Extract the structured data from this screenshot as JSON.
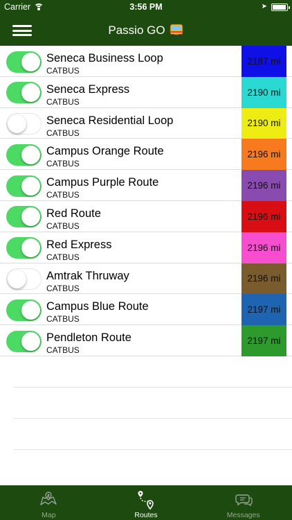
{
  "status_bar": {
    "carrier": "Carrier",
    "time": "3:56 PM"
  },
  "header": {
    "title": "Passio GO",
    "menu_icon": "hamburger-menu-icon",
    "title_icon": "bus-icon"
  },
  "routes": [
    {
      "name": "Seneca Business Loop",
      "agency": "CATBUS",
      "enabled": true,
      "distance": "2187 mi",
      "color": "#0f0fe8",
      "text_color": "#111111"
    },
    {
      "name": "Seneca Express",
      "agency": "CATBUS",
      "enabled": true,
      "distance": "2190 mi",
      "color": "#2bd9d3",
      "text_color": "#111111"
    },
    {
      "name": "Seneca Residential Loop",
      "agency": "CATBUS",
      "enabled": false,
      "distance": "2190 mi",
      "color": "#eded14",
      "text_color": "#111111"
    },
    {
      "name": "Campus Orange Route",
      "agency": "CATBUS",
      "enabled": true,
      "distance": "2196 mi",
      "color": "#f77a1e",
      "text_color": "#111111"
    },
    {
      "name": "Campus Purple Route",
      "agency": "CATBUS",
      "enabled": true,
      "distance": "2196 mi",
      "color": "#8a4bb0",
      "text_color": "#111111"
    },
    {
      "name": "Red Route",
      "agency": "CATBUS",
      "enabled": true,
      "distance": "2196 mi",
      "color": "#d90d14",
      "text_color": "#111111"
    },
    {
      "name": "Red Express",
      "agency": "CATBUS",
      "enabled": true,
      "distance": "2196 mi",
      "color": "#f74ecf",
      "text_color": "#111111"
    },
    {
      "name": "Amtrak Thruway",
      "agency": "CATBUS",
      "enabled": false,
      "distance": "2196 mi",
      "color": "#7a5b2e",
      "text_color": "#111111"
    },
    {
      "name": "Campus Blue Route",
      "agency": "CATBUS",
      "enabled": true,
      "distance": "2197 mi",
      "color": "#1f64b0",
      "text_color": "#111111"
    },
    {
      "name": "Pendleton Route",
      "agency": "CATBUS",
      "enabled": true,
      "distance": "2197 mi",
      "color": "#2c9a2c",
      "text_color": "#111111"
    }
  ],
  "tabs": [
    {
      "label": "Map",
      "icon": "map-icon",
      "active": false
    },
    {
      "label": "Routes",
      "icon": "routes-icon",
      "active": true
    },
    {
      "label": "Messages",
      "icon": "messages-icon",
      "active": false
    }
  ],
  "colors": {
    "header_bg": "#1d4a0e",
    "toggle_on": "#4cd964",
    "tab_inactive": "#9aa39a"
  }
}
